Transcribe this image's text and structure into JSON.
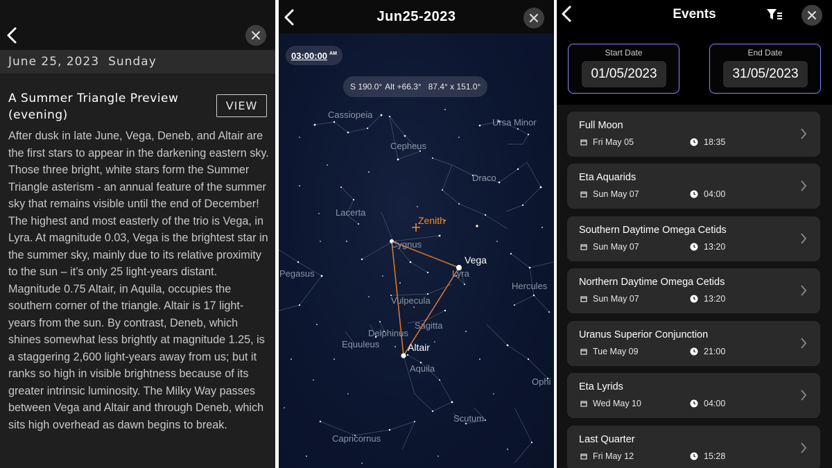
{
  "detail_panel": {
    "date": "June 25, 2023",
    "weekday": "Sunday",
    "event_title": "A Summer Triangle Preview (evening)",
    "view_label": "VIEW",
    "body": "After dusk in late June, Vega, Deneb, and Altair are the first stars to appear in the darkening eastern sky. Those three bright, white stars form the Summer Triangle asterism - an annual feature of the summer sky that remains visible until the end of December! The highest and most easterly of the trio is Vega, in Lyra. At magnitude 0.03, Vega is the brightest star in the summer sky, mainly due to its relative proximity to the sun – it’s only 25 light-years distant. Magnitude 0.75 Altair, in Aquila, occupies the southern corner of the triangle. Altair is 17 light-years from the sun. By contrast, Deneb, which shines somewhat less brightly at magnitude 1.25, is a staggering 2,600 light-years away from us; but it ranks so high in visible brightness because of its greater intrinsic luminosity. The Milky Way passes between Vega and Altair and through Deneb, which sits high overhead as dawn begins to break."
  },
  "sky_panel": {
    "title": "Jun25-2023",
    "time": "03:00:00",
    "ampm": "AM",
    "readout_direction": "S 190.0°",
    "readout_altitude": "Alt +66.3°",
    "readout_fov": "87.4° x 151.0°",
    "constellations": {
      "cassiopeia": "Cassiopeia",
      "ursa_minor": "Ursa Minor",
      "cepheus": "Cepheus",
      "draco": "Draco",
      "lacerta": "Lacerta",
      "cygnus": "Cygnus",
      "pegasus": "Pegasus",
      "lyra": "Lyra",
      "hercules": "Hercules",
      "vulpecula": "Vulpecula",
      "sagitta": "Sagitta",
      "delphinus": "Delphinus",
      "equuleus": "Equuleus",
      "aquila": "Aquila",
      "ophiuchus": "Ophi",
      "scutum": "Scutum",
      "capricornus": "Capricornus"
    },
    "stars": {
      "vega": "Vega",
      "altair": "Altair"
    },
    "zenith": "Zenith",
    "colors": {
      "triangle": "#d9742a",
      "zenith": "#ff8a1f"
    }
  },
  "events_panel": {
    "title": "Events",
    "start_label": "Start Date",
    "start_value": "01/05/2023",
    "end_label": "End Date",
    "end_value": "31/05/2023",
    "accent_color": "#8a86ff",
    "events": [
      {
        "name": "Full Moon",
        "date": "Fri May 05",
        "time": "18:35"
      },
      {
        "name": "Eta Aquarids",
        "date": "Sun May 07",
        "time": "04:00"
      },
      {
        "name": "Southern Daytime Omega Cetids",
        "date": "Sun May 07",
        "time": "13:20"
      },
      {
        "name": "Northern Daytime Omega Cetids",
        "date": "Sun May 07",
        "time": "13:20"
      },
      {
        "name": "Uranus Superior Conjunction",
        "date": "Tue May 09",
        "time": "21:00"
      },
      {
        "name": "Eta Lyrids",
        "date": "Wed May 10",
        "time": "04:00"
      },
      {
        "name": "Last Quarter",
        "date": "Fri May 12",
        "time": "15:28"
      }
    ]
  }
}
